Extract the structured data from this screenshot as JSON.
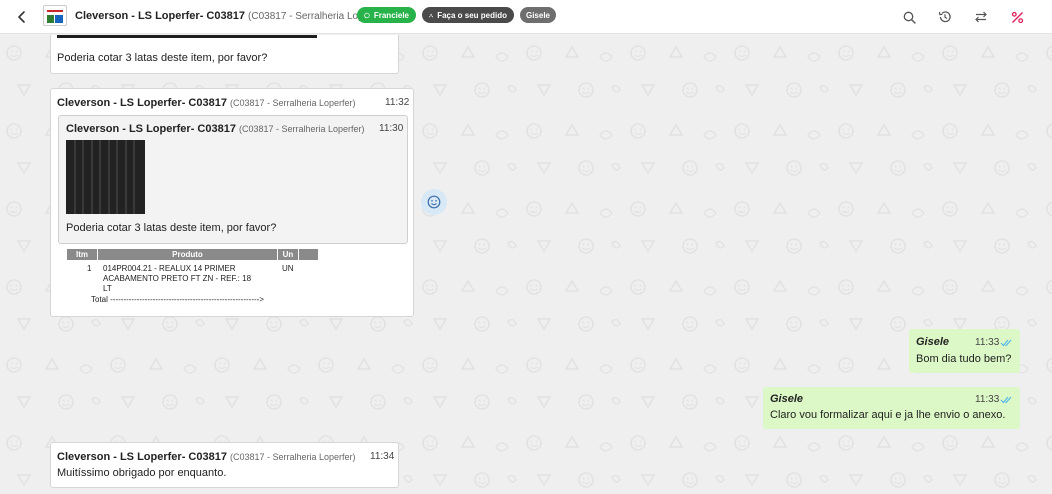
{
  "header": {
    "contact_name": "Cleverson - LS Loperfer- C03817",
    "contact_sub": "(C03817 - Serralheria Loperfer)",
    "chips": {
      "agent": "Franciele",
      "order": "Faça o seu pedido",
      "user": "Gisele"
    },
    "icons": [
      "back-arrow-icon",
      "search-icon",
      "history-icon",
      "transfer-icon",
      "percent-icon"
    ],
    "colors": {
      "chip_green": "#27b34a",
      "chip_dark": "#4a4a4a",
      "chip_gray": "#6e6e6e",
      "percent_icon": "#e0245e"
    }
  },
  "messages": {
    "m1": {
      "text": "Poderia cotar 3 latas deste item, por favor?"
    },
    "m2": {
      "sender": "Cleverson - LS Loperfer- C03817",
      "sender_sub": "(C03817 - Serralheria Loperfer)",
      "time": "11:32",
      "quote": {
        "sender": "Cleverson - LS Loperfer- C03817",
        "sender_sub": "(C03817 - Serralheria Loperfer)",
        "time": "11:30",
        "text": "Poderia cotar 3 latas deste item, por favor?"
      },
      "table": {
        "headers": [
          "Itm",
          "Produto",
          "Un",
          ""
        ],
        "row": {
          "item": "1",
          "product_line1": "014PR004.21 - REALUX 14 PRIMER",
          "product_line2": "ACABAMENTO PRETO FT ZN - REF.: 18",
          "product_line3": "LT",
          "unit": "UN"
        },
        "total": "Total -------------------------------------------------------->"
      }
    },
    "m3": {
      "sender": "Gisele",
      "time": "11:33",
      "text": "Bom dia tudo bem?"
    },
    "m4": {
      "sender": "Gisele",
      "time": "11:33",
      "text": "Claro vou formalizar aqui e ja lhe envio o anexo."
    },
    "m5": {
      "sender": "Cleverson - LS Loperfer- C03817",
      "sender_sub": "(C03817 - Serralheria Loperfer)",
      "time": "11:34",
      "text": "Muitíssimo obrigado por enquanto."
    }
  },
  "colors": {
    "outgoing_bubble": "#dcf8c6",
    "read_ticks": "#4fb6ec",
    "chat_bg": "#efefef"
  }
}
